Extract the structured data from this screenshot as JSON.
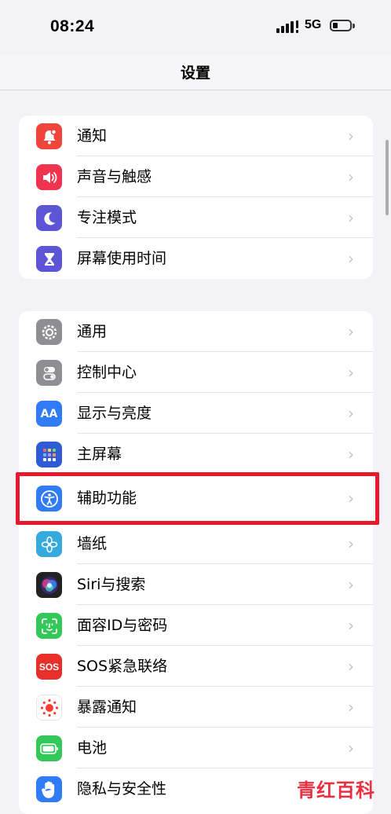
{
  "status": {
    "time": "08:24",
    "network": "5G"
  },
  "nav": {
    "title": "设置"
  },
  "groups": [
    {
      "items": [
        {
          "label": "通知",
          "icon": "notification-icon",
          "color": "#f0453a"
        },
        {
          "label": "声音与触感",
          "icon": "sound-icon",
          "color": "#f0344f"
        },
        {
          "label": "专注模式",
          "icon": "moon-icon",
          "color": "#5c55d5"
        },
        {
          "label": "屏幕使用时间",
          "icon": "hourglass-icon",
          "color": "#5c55d5"
        }
      ]
    },
    {
      "items": [
        {
          "label": "通用",
          "icon": "gear-icon",
          "color": "#8e8e93"
        },
        {
          "label": "控制中心",
          "icon": "toggles-icon",
          "color": "#8e8e93"
        },
        {
          "label": "显示与亮度",
          "icon": "display-icon",
          "color": "#2f7cf6"
        },
        {
          "label": "主屏幕",
          "icon": "home-screen-icon",
          "color": "#2f5bd6"
        },
        {
          "label": "辅助功能",
          "icon": "accessibility-icon",
          "color": "#2f7cf6"
        },
        {
          "label": "墙纸",
          "icon": "wallpaper-icon",
          "color": "#35aadc"
        },
        {
          "label": "Siri与搜索",
          "icon": "siri-icon",
          "color": "#222222"
        },
        {
          "label": "面容ID与密码",
          "icon": "faceid-icon",
          "color": "#34c759"
        },
        {
          "label": "SOS紧急联络",
          "icon": "sos-icon",
          "color": "#e8302a"
        },
        {
          "label": "暴露通知",
          "icon": "exposure-icon",
          "color": "#ffffff"
        },
        {
          "label": "电池",
          "icon": "battery-icon",
          "color": "#34c759"
        },
        {
          "label": "隐私与安全性",
          "icon": "hand-icon",
          "color": "#2f7cf6"
        }
      ]
    }
  ],
  "icon_texts": {
    "display": "AA",
    "sos": "SOS"
  },
  "watermark": "青红百科"
}
